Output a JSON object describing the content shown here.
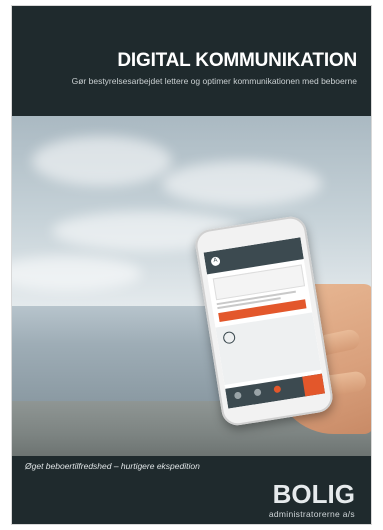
{
  "header": {
    "title": "DIGITAL KOMMUNIKATION",
    "subtitle": "Gør bestyrelsesarbejdet lettere og optimer kommunikationen med beboerne"
  },
  "tagline": "Øget beboertilfredshed – hurtigere ekspedition",
  "logo": {
    "main": "BOLIG",
    "sub": "administratorerne a/s"
  },
  "colors": {
    "background": "#1f2a2d",
    "accent": "#e3572b",
    "text": "#ffffff"
  }
}
